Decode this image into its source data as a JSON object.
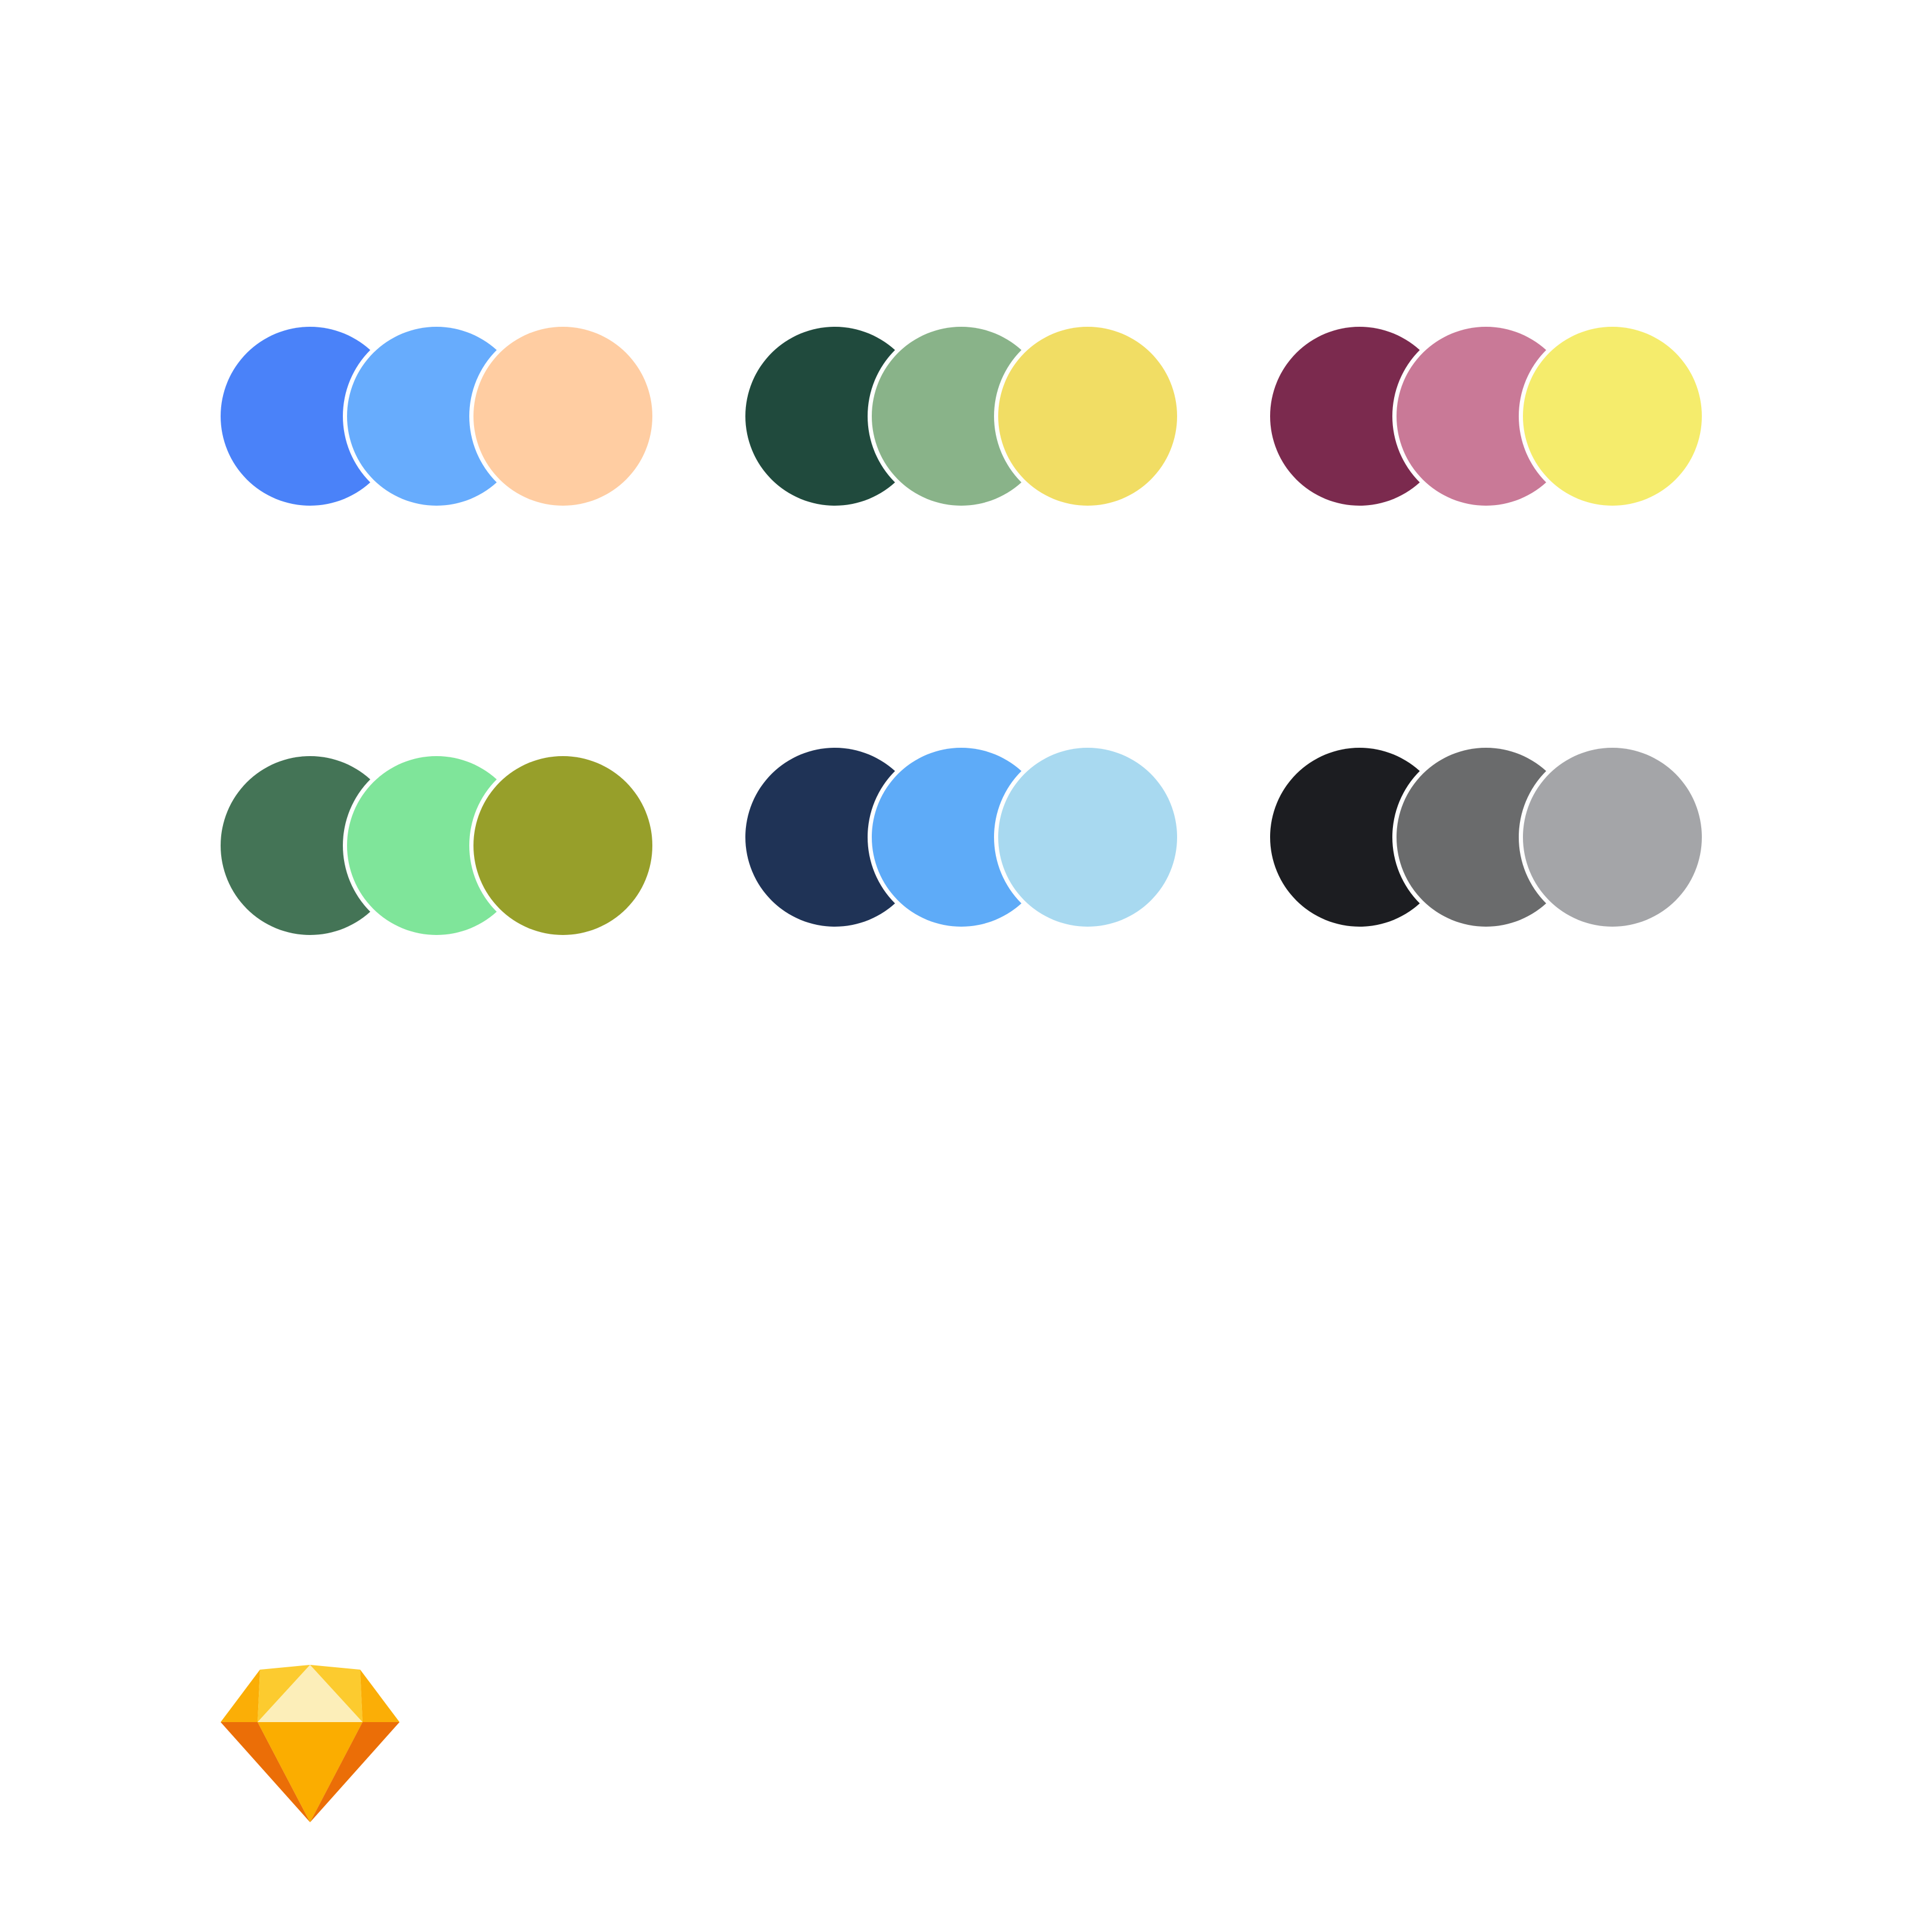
{
  "palettes": [
    {
      "name": "",
      "colors": [
        "#4A82F9",
        "#67ACFD",
        "#FFCDA2"
      ]
    },
    {
      "name": "",
      "colors": [
        "#204A3D",
        "#89B389",
        "#F1DD64"
      ]
    },
    {
      "name": "",
      "colors": [
        "#7B2A4E",
        "#C97997",
        "#F5EC6C"
      ]
    },
    {
      "name": "",
      "colors": [
        "#447456",
        "#7FE59A",
        "#979F2A"
      ]
    },
    {
      "name": "",
      "colors": [
        "#1F3356",
        "#5EABF8",
        "#A8D9F0"
      ]
    },
    {
      "name": "",
      "colors": [
        "#1C1D21",
        "#6A6B6C",
        "#A4A5A8"
      ]
    }
  ],
  "logo": {
    "icon": "sketch-diamond-icon",
    "colors": {
      "top_left": "#FCCB2F",
      "top_center": "#FCEEB9",
      "top_outer": "#FBAE06",
      "body_center": "#FBAD00",
      "body_outer": "#EB6E07"
    }
  }
}
